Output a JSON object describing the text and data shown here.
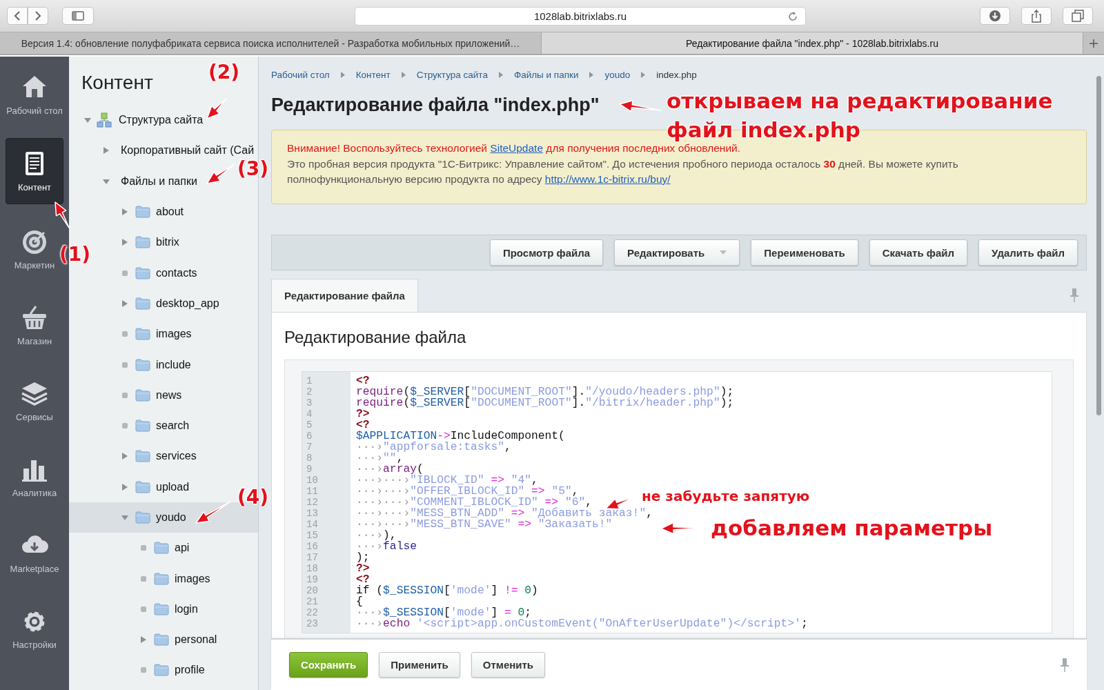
{
  "browser": {
    "url": "1028lab.bitrixlabs.ru",
    "tabs": [
      {
        "title": "Версия 1.4: обновление полуфабриката сервиса поиска исполнителей - Разработка мобильных приложений…",
        "selected": false
      },
      {
        "title": "Редактирование файла \"index.php\" - 1028lab.bitrixlabs.ru",
        "selected": true
      }
    ]
  },
  "sidebar": {
    "items": [
      {
        "label": "Рабочий стол",
        "kind": "home",
        "selected": false
      },
      {
        "label": "Контент",
        "kind": "document",
        "selected": true
      },
      {
        "label": "Маркетин",
        "kind": "target",
        "selected": false
      },
      {
        "label": "Магазин",
        "kind": "basket",
        "selected": false
      },
      {
        "label": "Сервисы",
        "kind": "layers",
        "selected": false
      },
      {
        "label": "Аналитика",
        "kind": "chart",
        "selected": false
      },
      {
        "label": "Marketplace",
        "kind": "cloud",
        "selected": false
      },
      {
        "label": "Настройки",
        "kind": "gear",
        "selected": false
      }
    ]
  },
  "tree": {
    "title": "Контент",
    "items": [
      {
        "label": "Структура сайта",
        "kind": "structure",
        "expandable": true,
        "expanded": true,
        "selected": false,
        "children": [
          {
            "label": "Корпоративный сайт (Сай",
            "kind": "section",
            "expandable": true,
            "expanded": false,
            "selected": false
          },
          {
            "label": "Файлы и папки",
            "kind": "section",
            "expandable": true,
            "expanded": true,
            "selected": false,
            "children": [
              {
                "label": "about",
                "kind": "folder",
                "expandable": true,
                "expanded": false,
                "selected": false
              },
              {
                "label": "bitrix",
                "kind": "folder",
                "expandable": true,
                "expanded": false,
                "selected": false
              },
              {
                "label": "contacts",
                "kind": "folder",
                "expandable": false,
                "expanded": false,
                "selected": false
              },
              {
                "label": "desktop_app",
                "kind": "folder",
                "expandable": true,
                "expanded": false,
                "selected": false
              },
              {
                "label": "images",
                "kind": "folder",
                "expandable": false,
                "expanded": false,
                "selected": false
              },
              {
                "label": "include",
                "kind": "folder",
                "expandable": false,
                "expanded": false,
                "selected": false
              },
              {
                "label": "news",
                "kind": "folder",
                "expandable": false,
                "expanded": false,
                "selected": false
              },
              {
                "label": "search",
                "kind": "folder",
                "expandable": false,
                "expanded": false,
                "selected": false
              },
              {
                "label": "services",
                "kind": "folder",
                "expandable": true,
                "expanded": false,
                "selected": false
              },
              {
                "label": "upload",
                "kind": "folder",
                "expandable": true,
                "expanded": false,
                "selected": false
              },
              {
                "label": "youdo",
                "kind": "folder",
                "expandable": true,
                "expanded": true,
                "selected": true,
                "children": [
                  {
                    "label": "api",
                    "kind": "folder",
                    "expandable": false,
                    "expanded": false,
                    "selected": false
                  },
                  {
                    "label": "images",
                    "kind": "folder",
                    "expandable": false,
                    "expanded": false,
                    "selected": false
                  },
                  {
                    "label": "login",
                    "kind": "folder",
                    "expandable": false,
                    "expanded": false,
                    "selected": false
                  },
                  {
                    "label": "personal",
                    "kind": "folder",
                    "expandable": true,
                    "expanded": false,
                    "selected": false
                  },
                  {
                    "label": "profile",
                    "kind": "folder",
                    "expandable": false,
                    "expanded": false,
                    "selected": false
                  }
                ]
              }
            ]
          }
        ]
      }
    ]
  },
  "breadcrumbs": [
    "Рабочий стол",
    "Контент",
    "Структура сайта",
    "Файлы и папки",
    "youdo",
    "index.php"
  ],
  "page_title": "Редактирование файла \"index.php\"",
  "notice": {
    "warning": {
      "before": "Внимание! Воспользуйтесь технологией ",
      "link": "SiteUpdate",
      "after": " для получения последних обновлений."
    },
    "trial": {
      "text": "Это пробная версия продукта \"1С-Битрикс: Управление сайтом\". До истечения пробного периода осталось **30** дней. Вы можете купить полнофункциональную версию продукта по адресу ",
      "link": "http://www.1c-bitrix.ru/buy/"
    }
  },
  "toolbar": [
    {
      "label": "Просмотр файла",
      "kind": "plain"
    },
    {
      "label": "Редактировать",
      "kind": "dropdown"
    },
    {
      "label": "Переименовать",
      "kind": "plain"
    },
    {
      "label": "Скачать файл",
      "kind": "plain"
    },
    {
      "label": "Удалить файл",
      "kind": "plain"
    }
  ],
  "tabs": [
    {
      "label": "Редактирование файла",
      "selected": true
    }
  ],
  "section_title": "Редактирование файла",
  "code": [
    {
      "number": "1",
      "tokens": [
        {
          "kind": "kw",
          "text": "<?"
        }
      ]
    },
    {
      "number": "2",
      "tokens": [
        {
          "kind": "fn",
          "text": "require"
        },
        {
          "kind": "plain",
          "text": "("
        },
        {
          "kind": "var",
          "text": "$_SERVER"
        },
        {
          "kind": "plain",
          "text": "["
        },
        {
          "kind": "str",
          "text": "\"DOCUMENT_ROOT\""
        },
        {
          "kind": "plain",
          "text": "]."
        },
        {
          "kind": "str",
          "text": "\"/youdo/headers.php\""
        },
        {
          "kind": "plain",
          "text": ");"
        }
      ]
    },
    {
      "number": "3",
      "tokens": [
        {
          "kind": "fn",
          "text": "require"
        },
        {
          "kind": "plain",
          "text": "("
        },
        {
          "kind": "var",
          "text": "$_SERVER"
        },
        {
          "kind": "plain",
          "text": "["
        },
        {
          "kind": "str",
          "text": "\"DOCUMENT_ROOT\""
        },
        {
          "kind": "plain",
          "text": "]."
        },
        {
          "kind": "str",
          "text": "\"/bitrix/header.php\""
        },
        {
          "kind": "plain",
          "text": ");"
        }
      ]
    },
    {
      "number": "4",
      "tokens": [
        {
          "kind": "kw",
          "text": "?>"
        }
      ]
    },
    {
      "number": "5",
      "tokens": [
        {
          "kind": "kw",
          "text": "<?"
        }
      ]
    },
    {
      "number": "6",
      "tokens": [
        {
          "kind": "var",
          "text": "$APPLICATION"
        },
        {
          "kind": "op",
          "text": "->"
        },
        {
          "kind": "plain",
          "text": "IncludeComponent("
        }
      ]
    },
    {
      "number": "7",
      "tokens": [
        {
          "kind": "tab",
          "text": "···›"
        },
        {
          "kind": "str",
          "text": "\"appforsale:tasks\""
        },
        {
          "kind": "plain",
          "text": ","
        }
      ]
    },
    {
      "number": "8",
      "tokens": [
        {
          "kind": "tab",
          "text": "···›"
        },
        {
          "kind": "str",
          "text": "\"\""
        },
        {
          "kind": "plain",
          "text": ","
        }
      ]
    },
    {
      "number": "9",
      "tokens": [
        {
          "kind": "tab",
          "text": "···›"
        },
        {
          "kind": "fn",
          "text": "array"
        },
        {
          "kind": "plain",
          "text": "("
        }
      ]
    },
    {
      "number": "10",
      "tokens": [
        {
          "kind": "tab",
          "text": "···›···›"
        },
        {
          "kind": "str",
          "text": "\"IBLOCK_ID\""
        },
        {
          "kind": "op",
          "text": " => "
        },
        {
          "kind": "str",
          "text": "\"4\""
        },
        {
          "kind": "plain",
          "text": ","
        }
      ]
    },
    {
      "number": "11",
      "tokens": [
        {
          "kind": "tab",
          "text": "···›···›"
        },
        {
          "kind": "str",
          "text": "\"OFFER_IBLOCK_ID\""
        },
        {
          "kind": "op",
          "text": " => "
        },
        {
          "kind": "str",
          "text": "\"5\""
        },
        {
          "kind": "plain",
          "text": ","
        }
      ]
    },
    {
      "number": "12",
      "tokens": [
        {
          "kind": "tab",
          "text": "···›···›"
        },
        {
          "kind": "str",
          "text": "\"COMMENT_IBLOCK_ID\""
        },
        {
          "kind": "op",
          "text": " => "
        },
        {
          "kind": "str",
          "text": "\"6\""
        },
        {
          "kind": "plain",
          "text": ","
        }
      ]
    },
    {
      "number": "13",
      "tokens": [
        {
          "kind": "tab",
          "text": "···›···›"
        },
        {
          "kind": "str",
          "text": "\"MESS_BTN_ADD\""
        },
        {
          "kind": "op",
          "text": " => "
        },
        {
          "kind": "str",
          "text": "\"Добавить заказ!\""
        },
        {
          "kind": "plain",
          "text": ","
        }
      ]
    },
    {
      "number": "14",
      "tokens": [
        {
          "kind": "tab",
          "text": "···›···›"
        },
        {
          "kind": "str",
          "text": "\"MESS_BTN_SAVE\""
        },
        {
          "kind": "op",
          "text": " => "
        },
        {
          "kind": "str",
          "text": "\"Заказать!\""
        }
      ]
    },
    {
      "number": "15",
      "tokens": [
        {
          "kind": "tab",
          "text": "···›"
        },
        {
          "kind": "plain",
          "text": "),"
        }
      ]
    },
    {
      "number": "16",
      "tokens": [
        {
          "kind": "tab",
          "text": "···›"
        },
        {
          "kind": "const",
          "text": "false"
        }
      ]
    },
    {
      "number": "17",
      "tokens": [
        {
          "kind": "plain",
          "text": ");"
        }
      ]
    },
    {
      "number": "18",
      "tokens": [
        {
          "kind": "kw",
          "text": "?>"
        }
      ]
    },
    {
      "number": "19",
      "tokens": [
        {
          "kind": "kw",
          "text": "<?"
        }
      ]
    },
    {
      "number": "20",
      "tokens": [
        {
          "kind": "plain",
          "text": "if ("
        },
        {
          "kind": "var",
          "text": "$_SESSION"
        },
        {
          "kind": "plain",
          "text": "["
        },
        {
          "kind": "str",
          "text": "'mode'"
        },
        {
          "kind": "plain",
          "text": "]"
        },
        {
          "kind": "op",
          "text": " != "
        },
        {
          "kind": "num",
          "text": "0"
        },
        {
          "kind": "plain",
          "text": ")"
        }
      ]
    },
    {
      "number": "21",
      "tokens": [
        {
          "kind": "plain",
          "text": "{"
        }
      ]
    },
    {
      "number": "22",
      "tokens": [
        {
          "kind": "tab",
          "text": "···›"
        },
        {
          "kind": "var",
          "text": "$_SESSION"
        },
        {
          "kind": "plain",
          "text": "["
        },
        {
          "kind": "str",
          "text": "'mode'"
        },
        {
          "kind": "plain",
          "text": "]"
        },
        {
          "kind": "op",
          "text": " = "
        },
        {
          "kind": "num",
          "text": "0"
        },
        {
          "kind": "plain",
          "text": ";"
        }
      ]
    },
    {
      "number": "23",
      "tokens": [
        {
          "kind": "tab",
          "text": "···›"
        },
        {
          "kind": "fn",
          "text": "echo"
        },
        {
          "kind": "str",
          "text": " '<script>app.onCustomEvent(\"OnAfterUserUpdate\")</script>'"
        },
        {
          "kind": "plain",
          "text": ";"
        }
      ]
    }
  ],
  "footer_buttons": [
    {
      "label": "Сохранить",
      "kind": "primary"
    },
    {
      "label": "Применить",
      "kind": "plain"
    },
    {
      "label": "Отменить",
      "kind": "plain"
    }
  ],
  "annotations": [
    {
      "text": "(1)",
      "kind": "number"
    },
    {
      "text": "(2)",
      "kind": "number"
    },
    {
      "text": "(3)",
      "kind": "number"
    },
    {
      "text": "(4)",
      "kind": "number"
    },
    {
      "text": "открываем на редактирование файл index.php",
      "kind": "note"
    },
    {
      "text": "не забудьте запятую",
      "kind": "small-note"
    },
    {
      "text": "добавляем параметры",
      "kind": "note"
    }
  ]
}
